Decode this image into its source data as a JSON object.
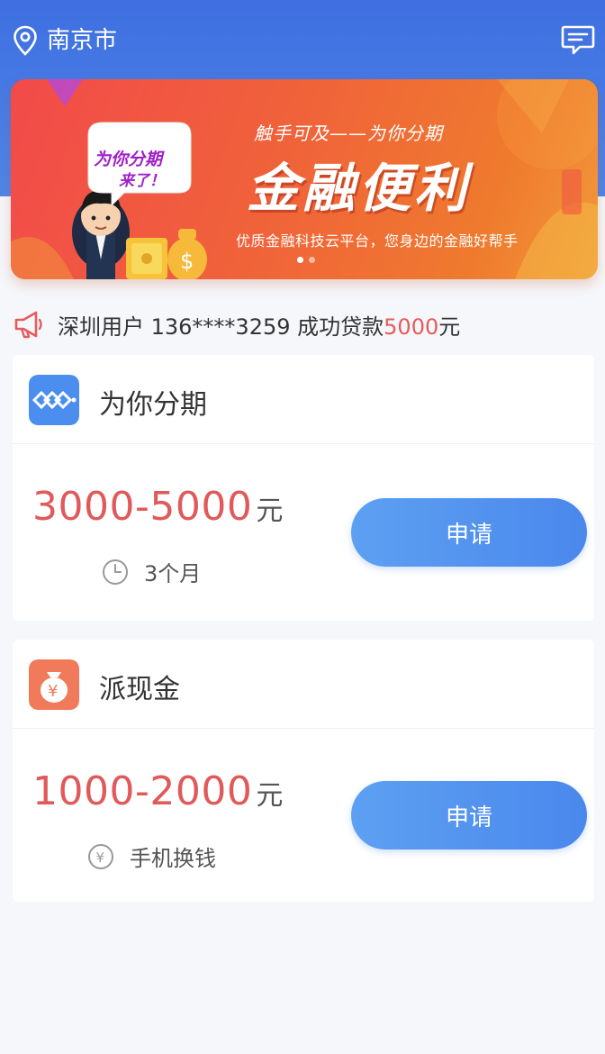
{
  "header": {
    "city": "南京市",
    "location_icon": "location-pin-icon",
    "message_icon": "message-icon"
  },
  "banner": {
    "subtitle": "触手可及——为你分期",
    "title": "金融便利",
    "description": "优质金融科技云平台，您身边的金融好帮手",
    "bubble_line1": "为你分期",
    "bubble_line2": "来了！",
    "slide_count": 2,
    "active_slide": 1
  },
  "notice": {
    "icon": "megaphone-icon",
    "text": "深圳用户 136****3259 成功贷款",
    "amount": "5000",
    "unit": "元"
  },
  "products": [
    {
      "name": "为你分期",
      "icon": "weinifenqi-logo-icon",
      "amount": "3000-5000",
      "unit": "元",
      "meta_icon": "clock-icon",
      "meta": "3个月",
      "button": "申请"
    },
    {
      "name": "派现金",
      "icon": "money-bag-icon",
      "amount": "1000-2000",
      "unit": "元",
      "meta_icon": "yen-icon",
      "meta": "手机换钱",
      "button": "申请"
    }
  ],
  "colors": {
    "header_blue": "#4a7fe6",
    "accent_red": "#e05a5a",
    "button_blue": "#4f8eee"
  }
}
